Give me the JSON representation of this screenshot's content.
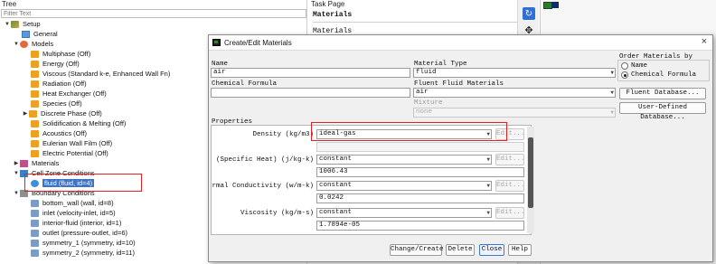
{
  "tree": {
    "title": "Tree",
    "filter_placeholder": "Filter Text",
    "setup": "Setup",
    "general": "General",
    "models": "Models",
    "model_items": [
      "Multiphase (Off)",
      "Energy (Off)",
      "Viscous (Standard k-e, Enhanced Wall Fn)",
      "Radiation (Off)",
      "Heat Exchanger (Off)",
      "Species (Off)",
      "Discrete Phase (Off)",
      "Solidification & Melting (Off)",
      "Acoustics (Off)",
      "Eulerian Wall Film (Off)",
      "Electric Potential (Off)"
    ],
    "materials": "Materials",
    "cell_zone": "Cell Zone Conditions",
    "fluid_zone": "fluid (fluid, id=4)",
    "boundary": "Boundary Conditions",
    "boundary_items": [
      "bottom_wall (wall, id=8)",
      "inlet (velocity-inlet, id=5)",
      "interior-fluid (interior, id=1)",
      "outlet (pressure-outlet, id=6)",
      "symmetry_1 (symmetry, id=10)",
      "symmetry_2 (symmetry, id=11)"
    ]
  },
  "task": {
    "title": "Task Page",
    "heading": "Materials",
    "subheading": "Materials"
  },
  "dialog": {
    "title": "Create/Edit Materials",
    "close_glyph": "×",
    "name_label": "Name",
    "name_value": "air",
    "chem_label": "Chemical Formula",
    "chem_value": "",
    "mat_type_label": "Material Type",
    "mat_type_value": "fluid",
    "fluent_fluid_label": "Fluent Fluid Materials",
    "fluent_fluid_value": "air",
    "mixture_label": "Mixture",
    "mixture_value": "none",
    "order_label": "Order Materials by",
    "order_options": [
      "Name",
      "Chemical Formula"
    ],
    "order_selected": "Chemical Formula",
    "fluent_db_btn": "Fluent Database...",
    "user_db_btn": "User-Defined Database...",
    "properties_label": "Properties",
    "edit_label": "Edit...",
    "properties": [
      {
        "label": "Density (kg/m3)",
        "method": "ideal-gas",
        "value": ""
      },
      {
        "label": "Cp (Specific Heat) (j/kg-k)",
        "method": "constant",
        "value": "1006.43"
      },
      {
        "label": "Thermal Conductivity (w/m-k)",
        "method": "constant",
        "value": "0.0242"
      },
      {
        "label": "Viscosity (kg/m-s)",
        "method": "constant",
        "value": "1.7894e-05"
      }
    ],
    "buttons": [
      "Change/Create",
      "Delete",
      "Close",
      "Help"
    ]
  },
  "colors": {
    "highlight": "#e52222",
    "selection": "#3a73c9",
    "primary_border": "#3d7ad6"
  }
}
